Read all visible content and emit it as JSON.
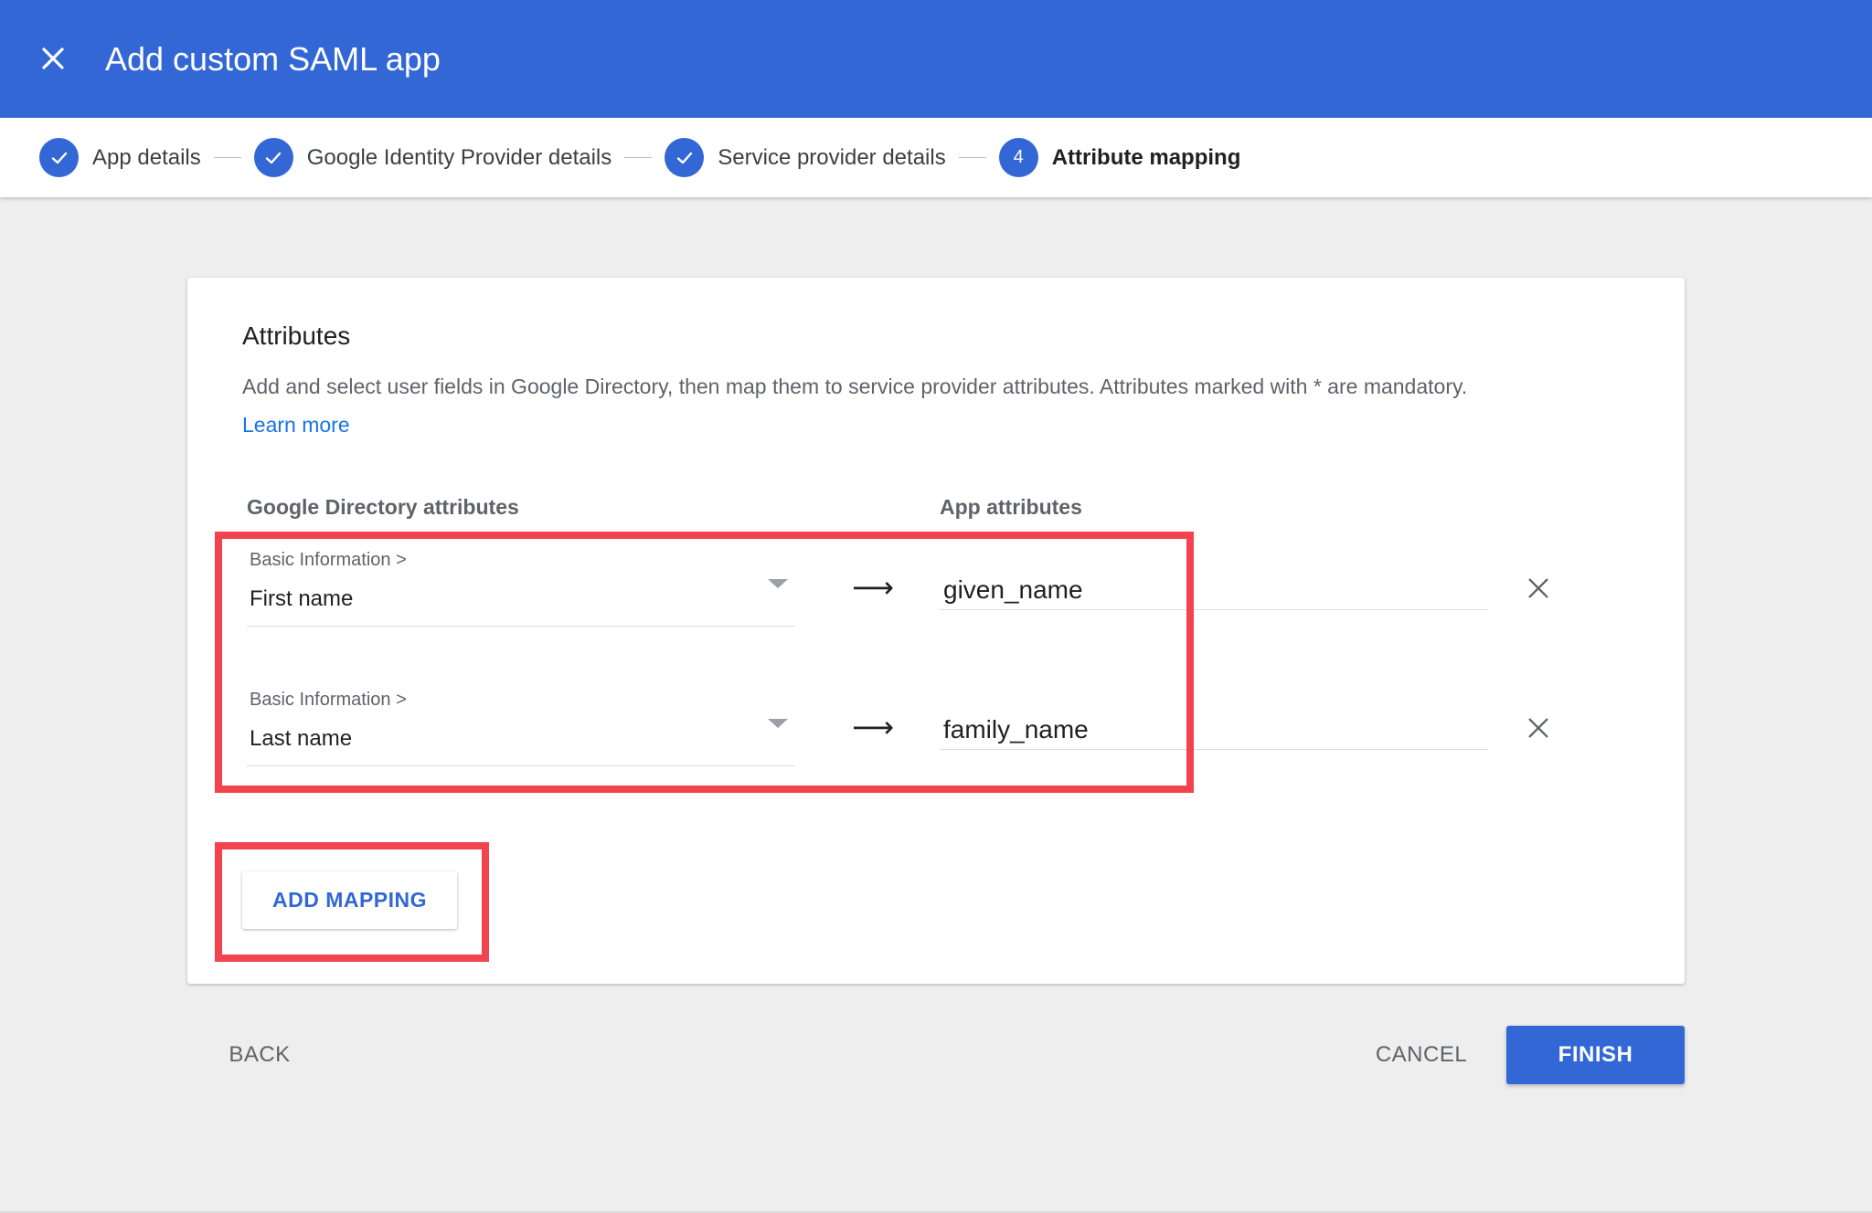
{
  "header": {
    "title": "Add custom SAML app",
    "close_icon": "close-icon"
  },
  "stepper": {
    "steps": [
      {
        "label": "App details",
        "state": "complete"
      },
      {
        "label": "Google Identity Provider details",
        "state": "complete"
      },
      {
        "label": "Service provider details",
        "state": "complete"
      },
      {
        "label": "Attribute mapping",
        "state": "active",
        "number": "4"
      }
    ]
  },
  "card": {
    "title": "Attributes",
    "description": "Add and select user fields in Google Directory, then map them to service provider attributes. Attributes marked with * are mandatory.",
    "learn_more": "Learn more",
    "col_left": "Google Directory attributes",
    "col_right": "App attributes",
    "mappings": [
      {
        "category": "Basic Information >",
        "field": "First name",
        "arrow": "⟶",
        "app_attribute": "given_name"
      },
      {
        "category": "Basic Information >",
        "field": "Last name",
        "arrow": "⟶",
        "app_attribute": "family_name"
      }
    ],
    "add_mapping_label": "ADD MAPPING"
  },
  "footer": {
    "back_label": "BACK",
    "cancel_label": "CANCEL",
    "finish_label": "FINISH"
  },
  "colors": {
    "primary": "#3367d6",
    "highlight": "#f2434e",
    "link": "#1a73e8"
  }
}
